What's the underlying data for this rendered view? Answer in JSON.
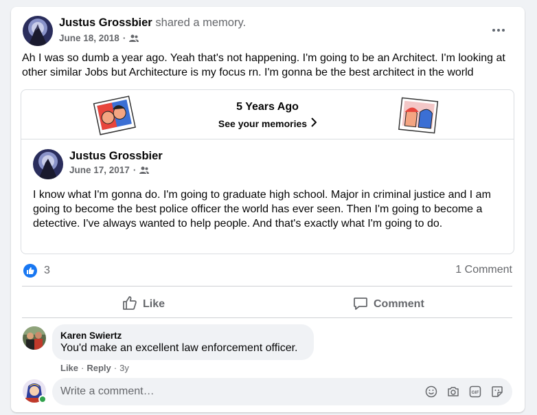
{
  "post": {
    "author": "Justus Grossbier",
    "shared_text": "shared a memory.",
    "date": "June 18, 2018",
    "audience_icon": "friends-icon",
    "text": "Ah I was so dumb a year ago. Yeah that's not happening. I'm going to be an Architect. I'm looking at other similar Jobs but Architecture is my focus rn. I'm gonna be the best architect in the world"
  },
  "memory": {
    "title": "5 Years Ago",
    "link": "See your memories",
    "original": {
      "author": "Justus Grossbier",
      "date": "June 17, 2017",
      "text": "I know what I'm gonna do. I'm going to graduate high school. Major in criminal justice and I am going to become the best police officer the world has ever seen. Then I'm going to become a detective. I've always wanted to help people. And that's exactly what I'm going to do."
    }
  },
  "stats": {
    "reaction_count": "3",
    "comment_count": "1 Comment"
  },
  "actions": {
    "like": "Like",
    "comment": "Comment"
  },
  "comment": {
    "author": "Karen Swiertz",
    "text": "You'd make an excellent law enforcement officer.",
    "like": "Like",
    "reply": "Reply",
    "sep": "·",
    "time": "3y"
  },
  "composer": {
    "placeholder": "Write a comment…"
  },
  "colors": {
    "accent": "#1877f2",
    "online": "#31a24c"
  }
}
